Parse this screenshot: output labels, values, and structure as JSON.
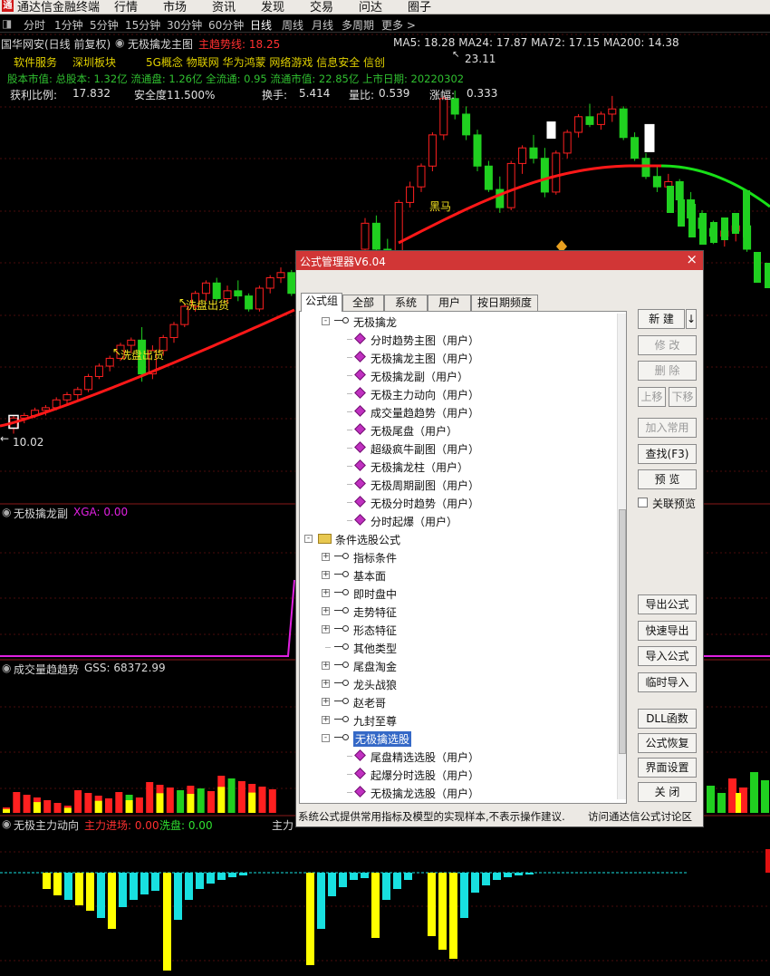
{
  "menubar": {
    "app_title": "通达信金融终端",
    "items": [
      "行情",
      "市场",
      "资讯",
      "发现",
      "交易",
      "问达",
      "圈子"
    ]
  },
  "periods": {
    "items": [
      "分时",
      "1分钟",
      "5分钟",
      "15分钟",
      "30分钟",
      "60分钟",
      "日线",
      "周线",
      "月线",
      "多周期",
      "更多 >"
    ],
    "active": "日线"
  },
  "stock": {
    "name": "国华网安(日线 前复权)",
    "indicator": "无极擒龙主图",
    "trend_label": "主趋势线: 18.25",
    "ma_line": "MA5: 18.28  MA24: 17.87  MA72: 17.15  MA200: 14.38",
    "info1": [
      "软件服务",
      "深圳板块",
      "5G概念 物联网 华为鸿蒙 网络游戏 信息安全 信创"
    ],
    "info2": "股本市值: 总股本: 1.32亿 流通盘: 1.26亿 全流通: 0.95 流通市值: 22.85亿 上市日期: 20220302",
    "info3_label1": "获利比例:",
    "info3_val1": "17.832",
    "info3_label2": "安全度11.500%",
    "info3_label3": "换手:",
    "info3_val3": "5.414",
    "info3_label4": "量比:",
    "info3_val4": "0.539",
    "info3_label5": "涨幅:",
    "info3_val5": "0.333",
    "high_label": "23.11",
    "low_label": "10.02",
    "annot_wash1": "洗盘出货",
    "annot_wash2": "洗盘出货",
    "annot_horse": "黑马"
  },
  "panels": {
    "p2_name": "无极擒龙副",
    "p2_val": "XGA: 0.00",
    "p3_name": "成交量趋趋势",
    "p3_val": "GSS: 68372.99",
    "p4_name": "无极主力动向",
    "p4_val1": "主力进场: 0.00",
    "p4_val2": "洗盘: 0.00",
    "p4_extra": "主力"
  },
  "colors": {
    "up": "#ff2020",
    "down": "#20d020",
    "trend": "#ff1818",
    "trend_green": "#18e018",
    "magenta": "#e020e0",
    "cyan": "#18e0e0",
    "yellow": "#ffff00",
    "dialog_title": "#d13636"
  },
  "chart_data": {
    "type": "candlestick",
    "price_high_label": 23.11,
    "price_low_label": 10.02,
    "ohlc": [
      [
        10.1,
        10.6,
        9.9,
        10.5
      ],
      [
        10.5,
        10.7,
        10.3,
        10.6
      ],
      [
        10.6,
        10.9,
        10.5,
        10.8
      ],
      [
        10.8,
        11.0,
        10.6,
        10.9
      ],
      [
        10.9,
        11.3,
        10.8,
        11.2
      ],
      [
        11.2,
        11.5,
        11.0,
        11.4
      ],
      [
        11.4,
        11.7,
        11.2,
        11.6
      ],
      [
        11.6,
        12.2,
        11.5,
        12.1
      ],
      [
        12.1,
        12.6,
        12.0,
        12.5
      ],
      [
        12.5,
        12.9,
        12.3,
        12.8
      ],
      [
        12.8,
        13.4,
        12.7,
        13.3
      ],
      [
        13.3,
        13.6,
        13.0,
        13.5
      ],
      [
        13.5,
        14.0,
        11.9,
        12.2
      ],
      [
        12.2,
        13.3,
        12.0,
        13.1
      ],
      [
        13.1,
        13.7,
        12.9,
        13.6
      ],
      [
        13.6,
        14.2,
        13.4,
        14.1
      ],
      [
        14.1,
        14.9,
        14.0,
        14.8
      ],
      [
        14.8,
        15.4,
        14.6,
        15.3
      ],
      [
        15.3,
        15.8,
        15.0,
        15.7
      ],
      [
        15.7,
        15.9,
        15.0,
        15.1
      ],
      [
        15.1,
        15.6,
        14.9,
        15.4
      ],
      [
        15.4,
        15.8,
        15.0,
        15.2
      ],
      [
        15.2,
        15.3,
        14.6,
        14.7
      ],
      [
        14.7,
        15.6,
        14.6,
        15.5
      ],
      [
        15.5,
        16.0,
        15.3,
        15.9
      ],
      [
        15.9,
        16.3,
        15.7,
        16.1
      ],
      [
        16.1,
        16.2,
        15.2,
        15.3
      ],
      [
        15.3,
        15.5,
        14.8,
        15.0
      ]
    ],
    "ohlc_right": [
      [
        17.0,
        18.2,
        16.9,
        18.0
      ],
      [
        18.0,
        18.3,
        16.8,
        17.0
      ],
      [
        17.0,
        17.4,
        16.5,
        16.8
      ],
      [
        16.8,
        18.9,
        16.7,
        18.8
      ],
      [
        18.8,
        19.6,
        18.6,
        19.4
      ],
      [
        19.4,
        20.3,
        19.2,
        20.2
      ],
      [
        20.2,
        21.5,
        20.0,
        21.4
      ],
      [
        21.4,
        22.9,
        21.2,
        22.8
      ],
      [
        22.8,
        23.11,
        22.0,
        22.2
      ],
      [
        22.2,
        22.5,
        21.2,
        21.4
      ],
      [
        21.4,
        21.6,
        20.0,
        20.2
      ],
      [
        20.2,
        20.4,
        19.2,
        19.3
      ],
      [
        19.3,
        19.8,
        18.4,
        18.6
      ],
      [
        18.6,
        20.4,
        18.5,
        20.3
      ],
      [
        20.3,
        21.0,
        19.9,
        20.9
      ],
      [
        20.9,
        21.4,
        20.3,
        20.5
      ],
      [
        20.5,
        20.9,
        19.0,
        19.2
      ],
      [
        19.2,
        20.8,
        19.1,
        20.7
      ],
      [
        20.7,
        21.6,
        20.5,
        21.5
      ],
      [
        21.5,
        22.2,
        21.3,
        22.1
      ],
      [
        22.1,
        22.6,
        21.7,
        21.8
      ],
      [
        21.8,
        22.3,
        21.6,
        22.2
      ],
      [
        22.2,
        22.9,
        21.9,
        22.4
      ],
      [
        22.4,
        22.5,
        21.2,
        21.3
      ],
      [
        21.3,
        21.5,
        20.4,
        20.5
      ],
      [
        20.5,
        20.7,
        19.7,
        19.8
      ],
      [
        19.8,
        20.2,
        19.2,
        19.4
      ],
      [
        19.4,
        19.9,
        19.0,
        19.6
      ],
      [
        19.6,
        19.7,
        18.7,
        18.9
      ],
      [
        18.9,
        19.2,
        18.0,
        18.2
      ],
      [
        18.2,
        18.5,
        17.6,
        17.8
      ],
      [
        17.8,
        18.1,
        17.2,
        17.5
      ],
      [
        17.5,
        17.9,
        17.1,
        17.7
      ],
      [
        17.7,
        18.1,
        17.3,
        17.9
      ],
      [
        17.9,
        18.0,
        16.9,
        17.0
      ]
    ],
    "ylim": [
      9.5,
      24.5
    ]
  },
  "dialog": {
    "title": "公式管理器V6.04",
    "close": "×",
    "tabs": [
      "公式组",
      "全部",
      "系统",
      "用户",
      "按日期频度"
    ],
    "tree": [
      {
        "label": "无极擒龙",
        "level": 1,
        "type": "group",
        "exp": "-"
      },
      {
        "label": "分时趋势主图（用户）",
        "level": 2,
        "type": "formula"
      },
      {
        "label": "无极擒龙主图（用户）",
        "level": 2,
        "type": "formula"
      },
      {
        "label": "无极擒龙副（用户）",
        "level": 2,
        "type": "formula"
      },
      {
        "label": "无极主力动向（用户）",
        "level": 2,
        "type": "formula"
      },
      {
        "label": "成交量趋趋势（用户）",
        "level": 2,
        "type": "formula"
      },
      {
        "label": "无极尾盘（用户）",
        "level": 2,
        "type": "formula"
      },
      {
        "label": "超级疯牛副图（用户）",
        "level": 2,
        "type": "formula"
      },
      {
        "label": "无极擒龙柱（用户）",
        "level": 2,
        "type": "formula"
      },
      {
        "label": "无极周期副图（用户）",
        "level": 2,
        "type": "formula"
      },
      {
        "label": "无极分时趋势（用户）",
        "level": 2,
        "type": "formula"
      },
      {
        "label": "分时起爆（用户）",
        "level": 2,
        "type": "formula"
      },
      {
        "label": "条件选股公式",
        "level": 0,
        "type": "folder",
        "exp": "-"
      },
      {
        "label": "指标条件",
        "level": 1,
        "type": "group",
        "exp": "+"
      },
      {
        "label": "基本面",
        "level": 1,
        "type": "group",
        "exp": "+"
      },
      {
        "label": "即时盘中",
        "level": 1,
        "type": "group",
        "exp": "+"
      },
      {
        "label": "走势特征",
        "level": 1,
        "type": "group",
        "exp": "+"
      },
      {
        "label": "形态特征",
        "level": 1,
        "type": "group",
        "exp": "+"
      },
      {
        "label": "其他类型",
        "level": 1,
        "type": "group",
        "exp": ""
      },
      {
        "label": "尾盘淘金",
        "level": 1,
        "type": "group",
        "exp": "+"
      },
      {
        "label": "龙头战狼",
        "level": 1,
        "type": "group",
        "exp": "+"
      },
      {
        "label": "赵老哥",
        "level": 1,
        "type": "group",
        "exp": "+"
      },
      {
        "label": "九封至尊",
        "level": 1,
        "type": "group",
        "exp": "+"
      },
      {
        "label": "无极擒选股",
        "level": 1,
        "type": "group",
        "exp": "-",
        "selected": true
      },
      {
        "label": "尾盘精选选股（用户）",
        "level": 2,
        "type": "formula"
      },
      {
        "label": "起爆分时选股（用户）",
        "level": 2,
        "type": "formula"
      },
      {
        "label": "无极擒龙选股（用户）",
        "level": 2,
        "type": "formula"
      }
    ],
    "buttons": {
      "new": "新 建",
      "new_arrow": "↓",
      "modify": "修 改",
      "delete": "删 除",
      "up": "上移",
      "down": "下移",
      "add_common": "加入常用",
      "find": "查找(F3)",
      "preview": "预 览",
      "link_preview": "关联预览",
      "export": "导出公式",
      "quick_export": "快速导出",
      "import": "导入公式",
      "temp_import": "临时导入",
      "dll": "DLL函数",
      "restore": "公式恢复",
      "ui": "界面设置",
      "close": "关 闭"
    },
    "status": "系统公式提供常用指标及模型的实现样本,不表示操作建议.",
    "forum": "访问通达信公式讨论区"
  }
}
